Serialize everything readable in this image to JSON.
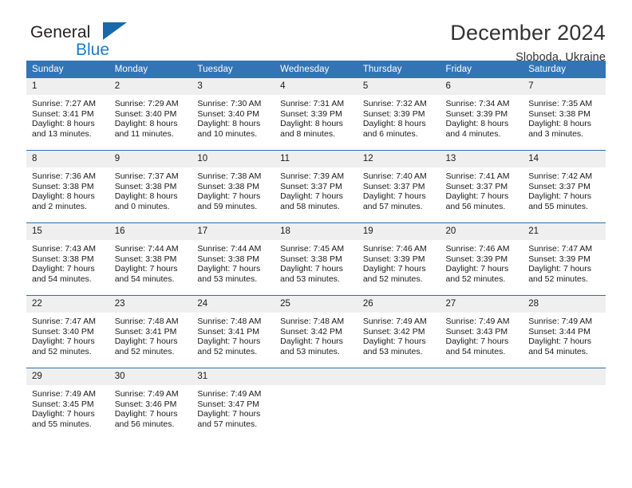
{
  "brand": {
    "name_part1": "General",
    "name_part2": "Blue",
    "triangle_color": "#1769ab",
    "blue_color": "#1d7cc4"
  },
  "header": {
    "title": "December 2024",
    "subtitle": "Sloboda, Ukraine"
  },
  "theme": {
    "header_bg": "#3474b4",
    "daynum_bg": "#efefef",
    "grid_line": "#2f6daa",
    "text": "#1a1a1a"
  },
  "weekdays": [
    "Sunday",
    "Monday",
    "Tuesday",
    "Wednesday",
    "Thursday",
    "Friday",
    "Saturday"
  ],
  "weeks": [
    [
      {
        "day": "1",
        "sunrise": "Sunrise: 7:27 AM",
        "sunset": "Sunset: 3:41 PM",
        "daylight1": "Daylight: 8 hours",
        "daylight2": "and 13 minutes."
      },
      {
        "day": "2",
        "sunrise": "Sunrise: 7:29 AM",
        "sunset": "Sunset: 3:40 PM",
        "daylight1": "Daylight: 8 hours",
        "daylight2": "and 11 minutes."
      },
      {
        "day": "3",
        "sunrise": "Sunrise: 7:30 AM",
        "sunset": "Sunset: 3:40 PM",
        "daylight1": "Daylight: 8 hours",
        "daylight2": "and 10 minutes."
      },
      {
        "day": "4",
        "sunrise": "Sunrise: 7:31 AM",
        "sunset": "Sunset: 3:39 PM",
        "daylight1": "Daylight: 8 hours",
        "daylight2": "and 8 minutes."
      },
      {
        "day": "5",
        "sunrise": "Sunrise: 7:32 AM",
        "sunset": "Sunset: 3:39 PM",
        "daylight1": "Daylight: 8 hours",
        "daylight2": "and 6 minutes."
      },
      {
        "day": "6",
        "sunrise": "Sunrise: 7:34 AM",
        "sunset": "Sunset: 3:39 PM",
        "daylight1": "Daylight: 8 hours",
        "daylight2": "and 4 minutes."
      },
      {
        "day": "7",
        "sunrise": "Sunrise: 7:35 AM",
        "sunset": "Sunset: 3:38 PM",
        "daylight1": "Daylight: 8 hours",
        "daylight2": "and 3 minutes."
      }
    ],
    [
      {
        "day": "8",
        "sunrise": "Sunrise: 7:36 AM",
        "sunset": "Sunset: 3:38 PM",
        "daylight1": "Daylight: 8 hours",
        "daylight2": "and 2 minutes."
      },
      {
        "day": "9",
        "sunrise": "Sunrise: 7:37 AM",
        "sunset": "Sunset: 3:38 PM",
        "daylight1": "Daylight: 8 hours",
        "daylight2": "and 0 minutes."
      },
      {
        "day": "10",
        "sunrise": "Sunrise: 7:38 AM",
        "sunset": "Sunset: 3:38 PM",
        "daylight1": "Daylight: 7 hours",
        "daylight2": "and 59 minutes."
      },
      {
        "day": "11",
        "sunrise": "Sunrise: 7:39 AM",
        "sunset": "Sunset: 3:37 PM",
        "daylight1": "Daylight: 7 hours",
        "daylight2": "and 58 minutes."
      },
      {
        "day": "12",
        "sunrise": "Sunrise: 7:40 AM",
        "sunset": "Sunset: 3:37 PM",
        "daylight1": "Daylight: 7 hours",
        "daylight2": "and 57 minutes."
      },
      {
        "day": "13",
        "sunrise": "Sunrise: 7:41 AM",
        "sunset": "Sunset: 3:37 PM",
        "daylight1": "Daylight: 7 hours",
        "daylight2": "and 56 minutes."
      },
      {
        "day": "14",
        "sunrise": "Sunrise: 7:42 AM",
        "sunset": "Sunset: 3:37 PM",
        "daylight1": "Daylight: 7 hours",
        "daylight2": "and 55 minutes."
      }
    ],
    [
      {
        "day": "15",
        "sunrise": "Sunrise: 7:43 AM",
        "sunset": "Sunset: 3:38 PM",
        "daylight1": "Daylight: 7 hours",
        "daylight2": "and 54 minutes."
      },
      {
        "day": "16",
        "sunrise": "Sunrise: 7:44 AM",
        "sunset": "Sunset: 3:38 PM",
        "daylight1": "Daylight: 7 hours",
        "daylight2": "and 54 minutes."
      },
      {
        "day": "17",
        "sunrise": "Sunrise: 7:44 AM",
        "sunset": "Sunset: 3:38 PM",
        "daylight1": "Daylight: 7 hours",
        "daylight2": "and 53 minutes."
      },
      {
        "day": "18",
        "sunrise": "Sunrise: 7:45 AM",
        "sunset": "Sunset: 3:38 PM",
        "daylight1": "Daylight: 7 hours",
        "daylight2": "and 53 minutes."
      },
      {
        "day": "19",
        "sunrise": "Sunrise: 7:46 AM",
        "sunset": "Sunset: 3:39 PM",
        "daylight1": "Daylight: 7 hours",
        "daylight2": "and 52 minutes."
      },
      {
        "day": "20",
        "sunrise": "Sunrise: 7:46 AM",
        "sunset": "Sunset: 3:39 PM",
        "daylight1": "Daylight: 7 hours",
        "daylight2": "and 52 minutes."
      },
      {
        "day": "21",
        "sunrise": "Sunrise: 7:47 AM",
        "sunset": "Sunset: 3:39 PM",
        "daylight1": "Daylight: 7 hours",
        "daylight2": "and 52 minutes."
      }
    ],
    [
      {
        "day": "22",
        "sunrise": "Sunrise: 7:47 AM",
        "sunset": "Sunset: 3:40 PM",
        "daylight1": "Daylight: 7 hours",
        "daylight2": "and 52 minutes."
      },
      {
        "day": "23",
        "sunrise": "Sunrise: 7:48 AM",
        "sunset": "Sunset: 3:41 PM",
        "daylight1": "Daylight: 7 hours",
        "daylight2": "and 52 minutes."
      },
      {
        "day": "24",
        "sunrise": "Sunrise: 7:48 AM",
        "sunset": "Sunset: 3:41 PM",
        "daylight1": "Daylight: 7 hours",
        "daylight2": "and 52 minutes."
      },
      {
        "day": "25",
        "sunrise": "Sunrise: 7:48 AM",
        "sunset": "Sunset: 3:42 PM",
        "daylight1": "Daylight: 7 hours",
        "daylight2": "and 53 minutes."
      },
      {
        "day": "26",
        "sunrise": "Sunrise: 7:49 AM",
        "sunset": "Sunset: 3:42 PM",
        "daylight1": "Daylight: 7 hours",
        "daylight2": "and 53 minutes."
      },
      {
        "day": "27",
        "sunrise": "Sunrise: 7:49 AM",
        "sunset": "Sunset: 3:43 PM",
        "daylight1": "Daylight: 7 hours",
        "daylight2": "and 54 minutes."
      },
      {
        "day": "28",
        "sunrise": "Sunrise: 7:49 AM",
        "sunset": "Sunset: 3:44 PM",
        "daylight1": "Daylight: 7 hours",
        "daylight2": "and 54 minutes."
      }
    ],
    [
      {
        "day": "29",
        "sunrise": "Sunrise: 7:49 AM",
        "sunset": "Sunset: 3:45 PM",
        "daylight1": "Daylight: 7 hours",
        "daylight2": "and 55 minutes."
      },
      {
        "day": "30",
        "sunrise": "Sunrise: 7:49 AM",
        "sunset": "Sunset: 3:46 PM",
        "daylight1": "Daylight: 7 hours",
        "daylight2": "and 56 minutes."
      },
      {
        "day": "31",
        "sunrise": "Sunrise: 7:49 AM",
        "sunset": "Sunset: 3:47 PM",
        "daylight1": "Daylight: 7 hours",
        "daylight2": "and 57 minutes."
      },
      {
        "day": "",
        "sunrise": "",
        "sunset": "",
        "daylight1": "",
        "daylight2": ""
      },
      {
        "day": "",
        "sunrise": "",
        "sunset": "",
        "daylight1": "",
        "daylight2": ""
      },
      {
        "day": "",
        "sunrise": "",
        "sunset": "",
        "daylight1": "",
        "daylight2": ""
      },
      {
        "day": "",
        "sunrise": "",
        "sunset": "",
        "daylight1": "",
        "daylight2": ""
      }
    ]
  ]
}
